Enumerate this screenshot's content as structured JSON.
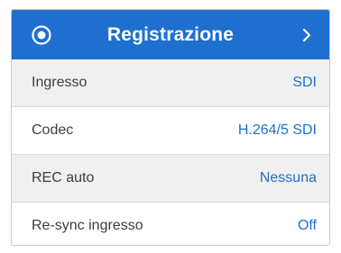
{
  "header": {
    "title": "Registrazione",
    "icon": "record-icon",
    "chevron_icon": "chevron-right-icon"
  },
  "settings": [
    {
      "label": "Ingresso",
      "value": "SDI"
    },
    {
      "label": "Codec",
      "value": "H.264/5 SDI"
    },
    {
      "label": "REC auto",
      "value": "Nessuna"
    },
    {
      "label": "Re-sync ingresso",
      "value": "Off"
    }
  ],
  "colors": {
    "accent": "#1f6fcf",
    "row_alt": "#f0f0f0",
    "label_text": "#3d3d3d"
  }
}
